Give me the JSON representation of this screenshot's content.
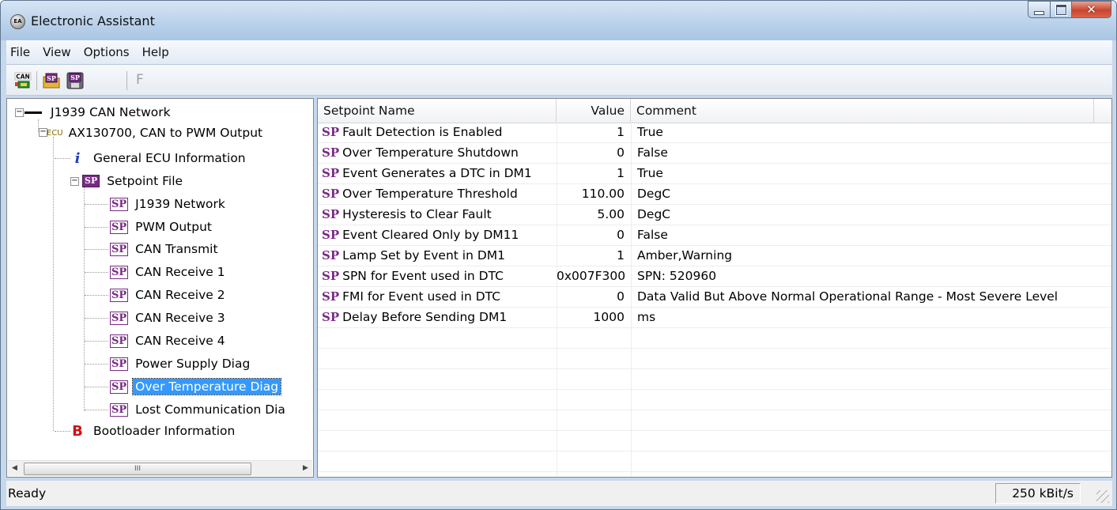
{
  "window": {
    "title": "Electronic Assistant",
    "icon_text": "EA"
  },
  "menu": [
    "File",
    "View",
    "Options",
    "Help"
  ],
  "toolbar": {
    "f_label": "F",
    "can_label": "CAN",
    "sp_label": "SP"
  },
  "tree": {
    "network": "J1939 CAN Network",
    "ecu_tag": "ECU",
    "ecu": "AX130700, CAN to PWM Output",
    "general": "General ECU Information",
    "info_glyph": "i",
    "setpoint_file": "Setpoint File",
    "sp_badge": "SP",
    "setpoints": [
      "J1939 Network",
      "PWM Output",
      "CAN Transmit",
      "CAN Receive 1",
      "CAN Receive 2",
      "CAN Receive 3",
      "CAN Receive 4",
      "Power Supply Diag",
      "Over Temperature Diag",
      "Lost Communication Dia"
    ],
    "selected_index": 8,
    "bootloader": "Bootloader Information",
    "boot_glyph": "B",
    "scroll_thumb": "III"
  },
  "table": {
    "headers": {
      "name": "Setpoint Name",
      "value": "Value",
      "comment": "Comment"
    },
    "prefix": "SP",
    "rows": [
      {
        "name": "Fault Detection is Enabled",
        "value": "1",
        "comment": "True"
      },
      {
        "name": "Over Temperature Shutdown",
        "value": "0",
        "comment": "False"
      },
      {
        "name": "Event Generates a DTC in DM1",
        "value": "1",
        "comment": "True"
      },
      {
        "name": "Over Temperature Threshold",
        "value": "110.00",
        "comment": "DegC"
      },
      {
        "name": "Hysteresis to Clear Fault",
        "value": "5.00",
        "comment": "DegC"
      },
      {
        "name": "Event Cleared Only by DM11",
        "value": "0",
        "comment": "False"
      },
      {
        "name": "Lamp Set by Event in DM1",
        "value": "1",
        "comment": "Amber,Warning"
      },
      {
        "name": "SPN for Event used in DTC",
        "value": "0x007F300",
        "comment": "SPN: 520960"
      },
      {
        "name": "FMI for Event used in DTC",
        "value": "0",
        "comment": "Data Valid But Above Normal Operational Range - Most Severe Level"
      },
      {
        "name": "Delay Before Sending DM1",
        "value": "1000",
        "comment": "ms"
      }
    ]
  },
  "status": {
    "text": "Ready",
    "rate": "250 kBit/s"
  },
  "colors": {
    "selection": "#3399ff",
    "sp_purple": "#7a2a86",
    "title_bar": "#b9d1ea"
  }
}
